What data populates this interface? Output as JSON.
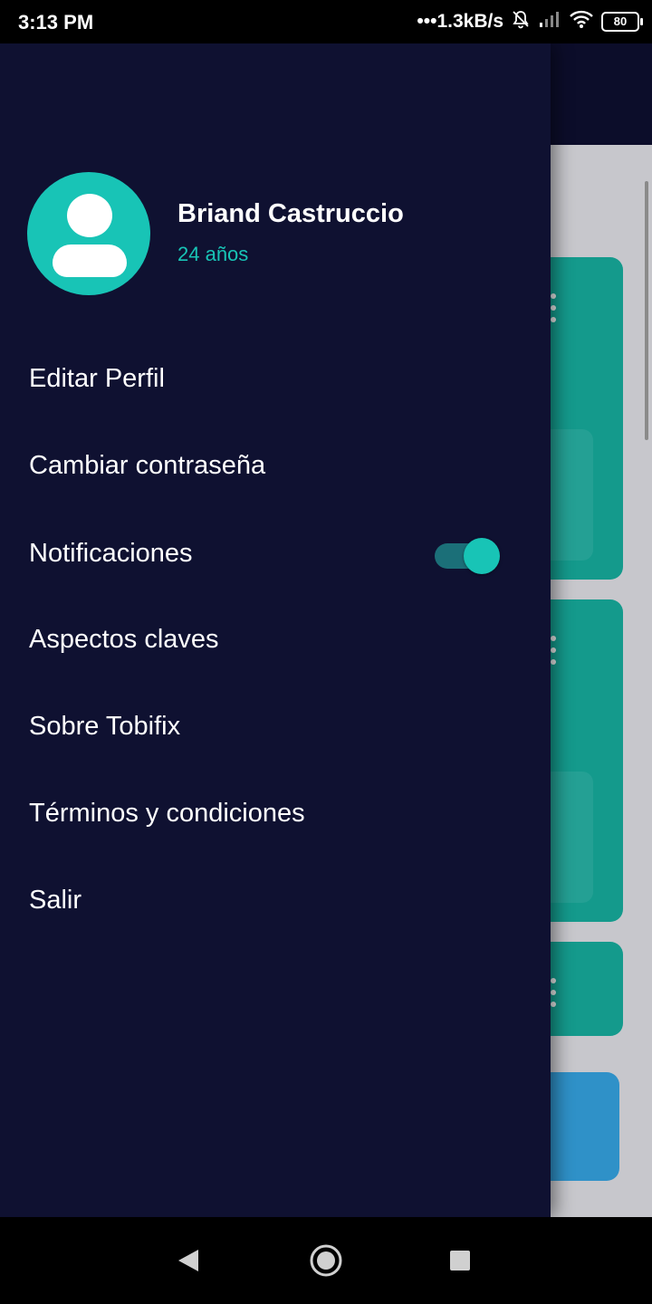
{
  "status_bar": {
    "time": "3:13 PM",
    "network_speed": "•••1.3kB/s",
    "battery_level": "80",
    "icons": [
      "bell-muted-icon",
      "signal-icon",
      "wifi-icon",
      "battery-icon"
    ]
  },
  "drawer": {
    "user": {
      "name": "Briand Castruccio",
      "age": "24 años",
      "avatar_icon": "person-avatar-icon"
    },
    "menu": {
      "edit_profile": "Editar Perfil",
      "change_password": "Cambiar contraseña",
      "notifications": "Notificaciones",
      "key_aspects": "Aspectos claves",
      "about": "Sobre Tobifix",
      "terms": "Términos y condiciones",
      "logout": "Salir"
    },
    "notifications_enabled": true
  },
  "nav_bar": {
    "icons": [
      "back-icon",
      "home-icon",
      "recents-icon"
    ]
  },
  "colors": {
    "drawer_bg": "#0f1131",
    "accent": "#18c4b6",
    "card_teal": "#149a8c",
    "card_blue": "#2f91c8"
  }
}
